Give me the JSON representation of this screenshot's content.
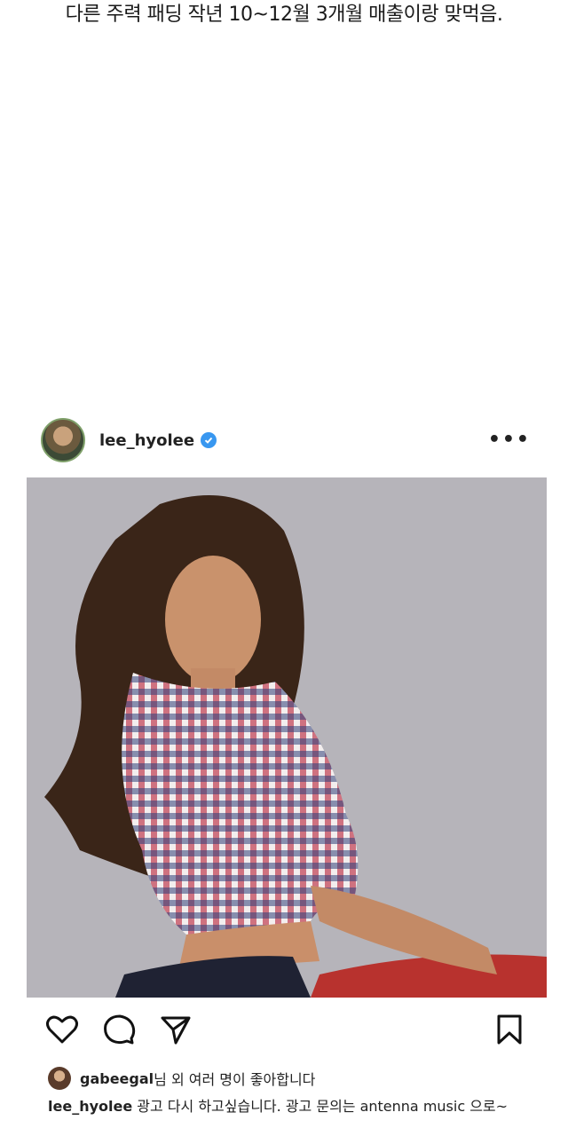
{
  "headline": "다른 주력 패딩 작년 10~12월 3개월 매출이랑 맞먹음.",
  "post": {
    "username": "lee_hyolee",
    "more_label": "•••",
    "verified_icon": "verified-badge-icon",
    "accent_color": "#3897f0"
  },
  "actions": {
    "like_icon": "heart-icon",
    "comment_icon": "comment-icon",
    "share_icon": "paper-plane-icon",
    "save_icon": "bookmark-icon"
  },
  "likes": {
    "liker": "gabeegal",
    "text": "님 외 여러 명이 좋아합니다"
  },
  "caption": {
    "username": "lee_hyolee",
    "text": " 광고 다시 하고싶습니다. 광고 문의는 antenna music 으로~"
  }
}
